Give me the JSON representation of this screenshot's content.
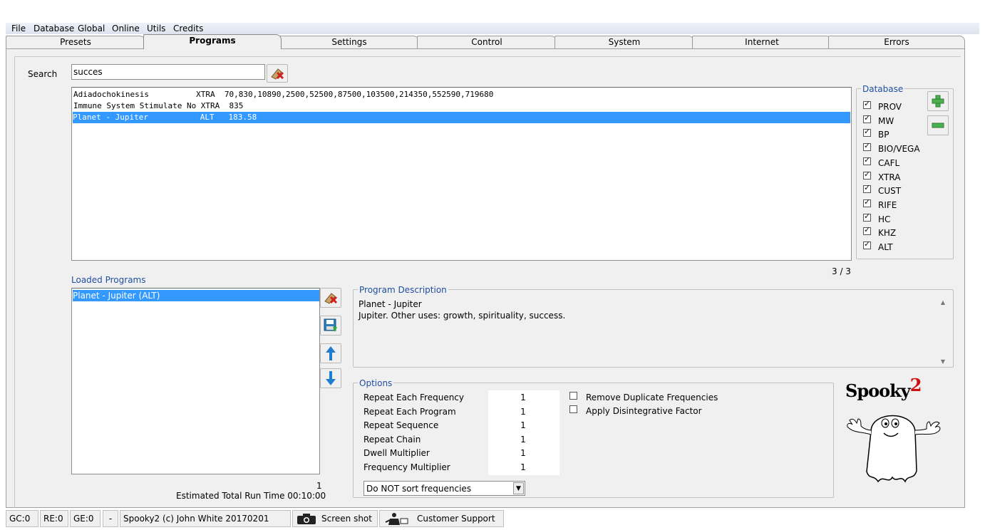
{
  "menu": [
    "File",
    "Database",
    "Global",
    "Online",
    "Utils",
    "Credits"
  ],
  "tabs": [
    "Presets",
    "Programs",
    "Settings",
    "Control",
    "System",
    "Internet",
    "Errors"
  ],
  "active_tab": "Programs",
  "search": {
    "label": "Search",
    "value": "succes"
  },
  "results": [
    {
      "text": "Adiadochokinesis          XTRA  70,830,10890,2500,52500,87500,103500,214350,552590,719680",
      "selected": false
    },
    {
      "text": "Immune System Stimulate No XTRA  835",
      "selected": false
    },
    {
      "text": "Planet - Jupiter           ALT   183.58",
      "selected": true
    }
  ],
  "result_count": "3 / 3",
  "database": {
    "title": "Database",
    "items": [
      "PROV",
      "MW",
      "BP",
      "BIO/VEGA",
      "CAFL",
      "XTRA",
      "CUST",
      "RIFE",
      "HC",
      "KHZ",
      "ALT"
    ],
    "add_icon": "plus-icon",
    "remove_icon": "minus-icon"
  },
  "loaded": {
    "title": "Loaded Programs",
    "items": [
      "Planet - Jupiter (ALT)"
    ],
    "count": "1",
    "run_time": "Estimated Total Run Time 00:10:00"
  },
  "description": {
    "title": "Program Description",
    "line1": "Planet - Jupiter",
    "line2": "Jupiter. Other uses: growth, spirituality, success."
  },
  "options": {
    "title": "Options",
    "rows": [
      {
        "label": "Repeat Each Frequency",
        "value": "1"
      },
      {
        "label": "Repeat Each Program",
        "value": "1"
      },
      {
        "label": "Repeat Sequence",
        "value": "1"
      },
      {
        "label": "Repeat Chain",
        "value": "1"
      },
      {
        "label": "Dwell Multiplier",
        "value": "1"
      },
      {
        "label": "Frequency Multiplier",
        "value": "1"
      }
    ],
    "checks": [
      "Remove Duplicate Frequencies",
      "Apply Disintegrative Factor"
    ],
    "sort_select": "Do NOT sort frequencies"
  },
  "logo": {
    "text": "Spooky",
    "sup": "2"
  },
  "status": {
    "gc": "GC:0",
    "re": "RE:0",
    "ge": "GE:0",
    "dash": "-",
    "copyright": "Spooky2 (c) John White 20170201",
    "screenshot": "Screen shot",
    "support": "Customer Support"
  },
  "colors": {
    "selection": "#3399ff",
    "accent_blue": "#1f4fa0"
  }
}
